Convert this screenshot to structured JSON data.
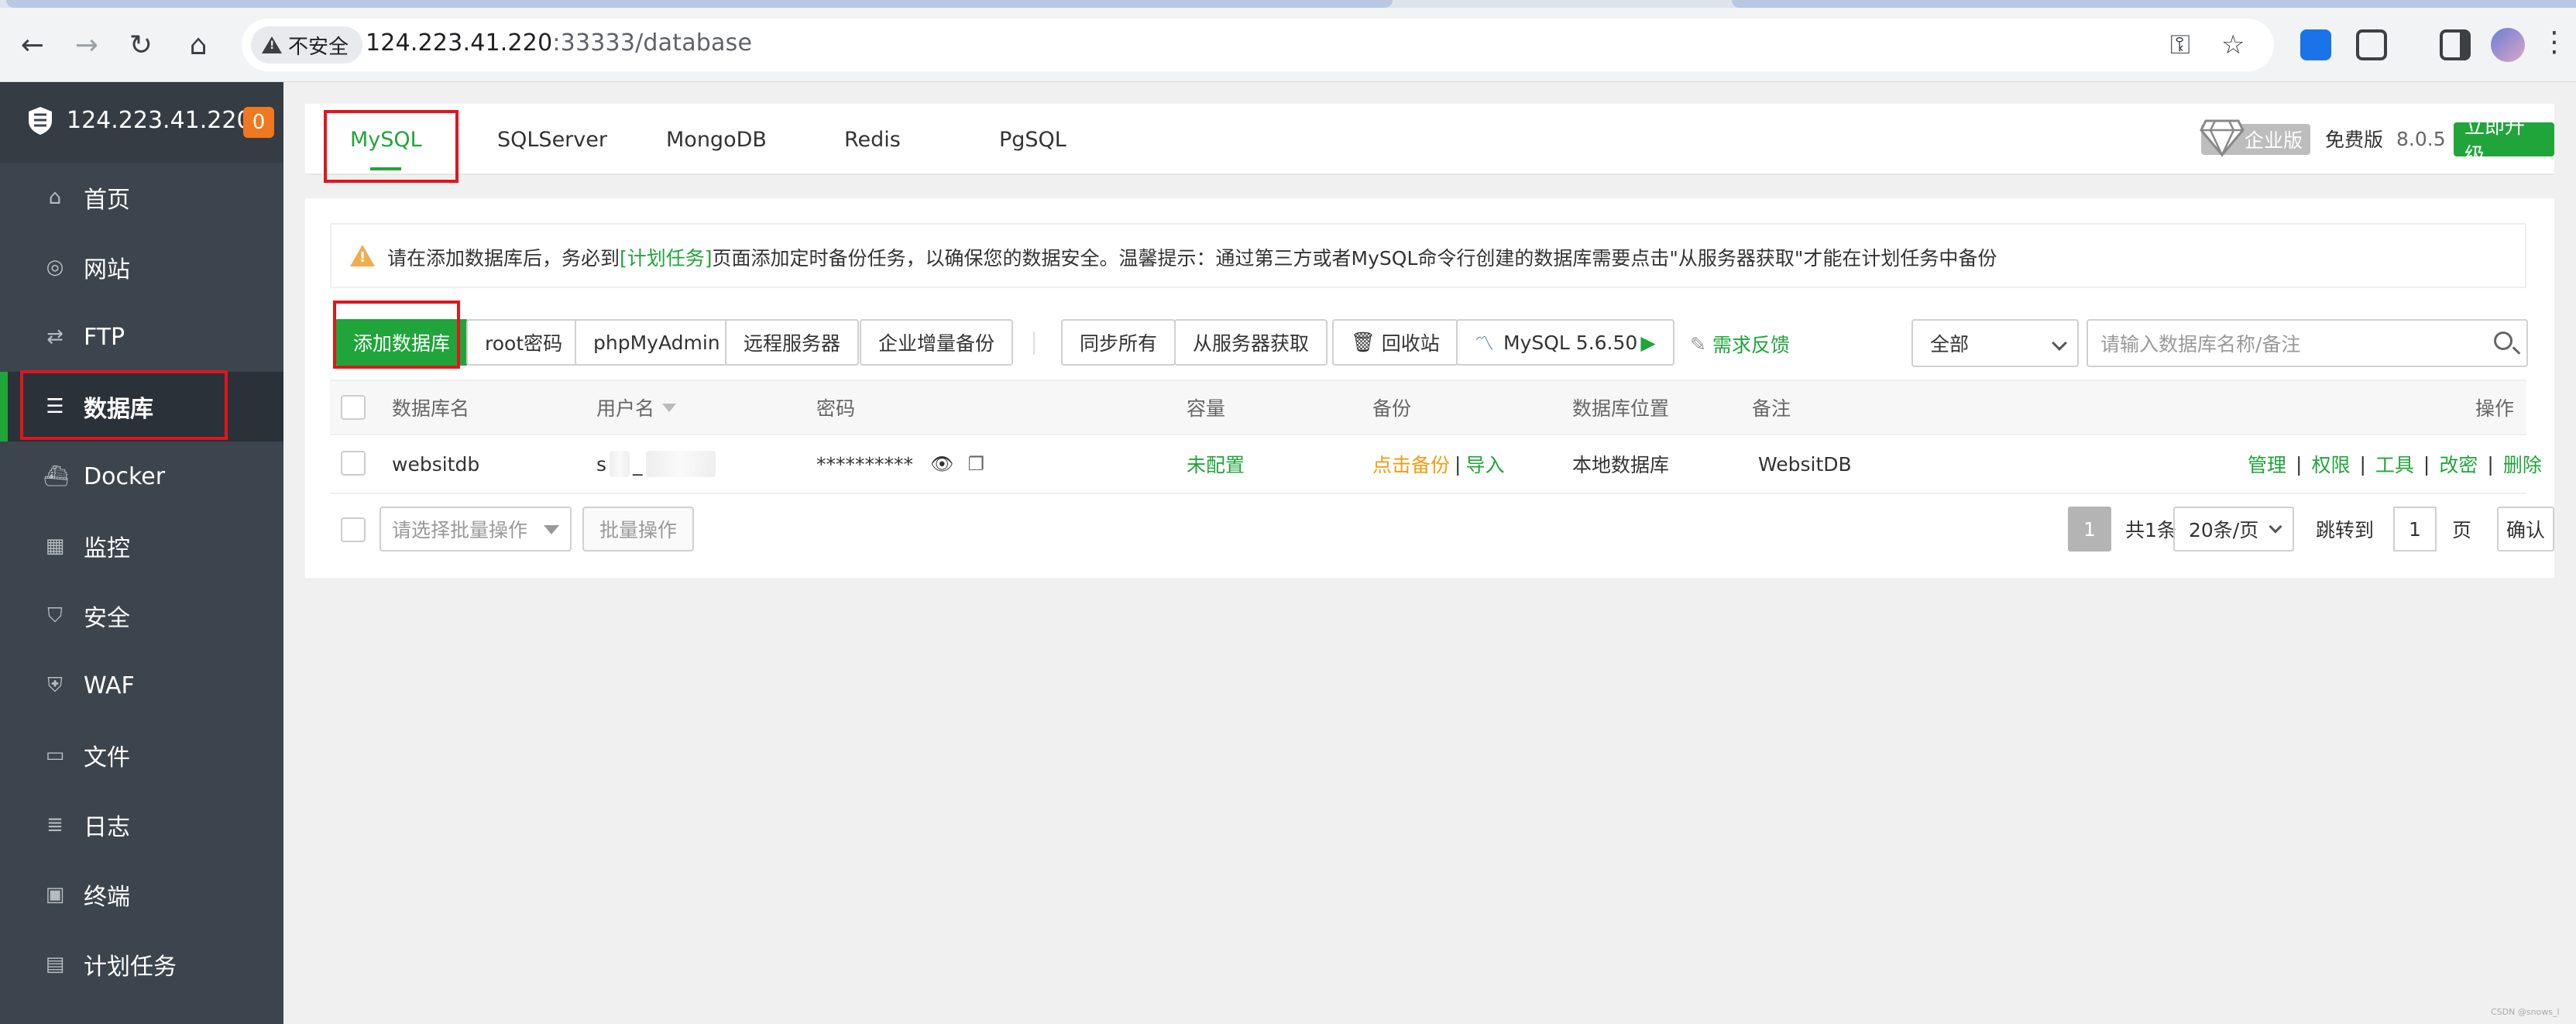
{
  "browser": {
    "insecure_label": "不安全",
    "url_host": "124.223.41.220",
    "url_rest": ":33333/database"
  },
  "sidebar": {
    "server_ip": "124.223.41.220",
    "badge": "0",
    "items": [
      {
        "label": "首页",
        "icon": "home-icon",
        "glyph": "⌂"
      },
      {
        "label": "网站",
        "icon": "globe-icon",
        "glyph": "◎"
      },
      {
        "label": "FTP",
        "icon": "ftp-icon",
        "glyph": "⇄"
      },
      {
        "label": "数据库",
        "icon": "database-icon",
        "glyph": "☰"
      },
      {
        "label": "Docker",
        "icon": "docker-icon",
        "glyph": "⛴"
      },
      {
        "label": "监控",
        "icon": "monitor-icon",
        "glyph": "▦"
      },
      {
        "label": "安全",
        "icon": "shield-icon",
        "glyph": "⛉"
      },
      {
        "label": "WAF",
        "icon": "waf-icon",
        "glyph": "⛨"
      },
      {
        "label": "文件",
        "icon": "folder-icon",
        "glyph": "▭"
      },
      {
        "label": "日志",
        "icon": "log-icon",
        "glyph": "≣"
      },
      {
        "label": "终端",
        "icon": "terminal-icon",
        "glyph": "▣"
      },
      {
        "label": "计划任务",
        "icon": "calendar-icon",
        "glyph": "▤"
      }
    ]
  },
  "db_tabs": [
    "MySQL",
    "SQLServer",
    "MongoDB",
    "Redis",
    "PgSQL"
  ],
  "edition": {
    "enterprise": "企业版",
    "free": "免费版",
    "version": "8.0.5",
    "upgrade": "立即升级"
  },
  "notice": {
    "before": "请在添加数据库后，务必到",
    "link": "[计划任务]",
    "after": "页面添加定时备份任务，以确保您的数据安全。温馨提示：通过第三方或者MySQL命令行创建的数据库需要点击\"从服务器获取\"才能在计划任务中备份"
  },
  "toolbar": {
    "add_db": "添加数据库",
    "root_pwd": "root密码",
    "phpmyadmin": "phpMyAdmin",
    "remote": "远程服务器",
    "incremental": "企业增量备份",
    "sync_all": "同步所有",
    "fetch": "从服务器获取",
    "recycle": "回收站",
    "mysql_version": "MySQL 5.6.50",
    "feedback": "需求反馈",
    "filter": "全部",
    "search_placeholder": "请输入数据库名称/备注"
  },
  "table": {
    "headers": {
      "name": "数据库名",
      "user": "用户名",
      "password": "密码",
      "capacity": "容量",
      "backup": "备份",
      "location": "数据库位置",
      "remark": "备注",
      "ops": "操作"
    },
    "rows": [
      {
        "name": "websitdb",
        "user": "s",
        "user_suffix": "_",
        "password": "**********",
        "capacity": "未配置",
        "backup_click": "点击备份",
        "backup_import": "导入",
        "location": "本地数据库",
        "remark": "WebsitDB",
        "ops": [
          "管理",
          "权限",
          "工具",
          "改密",
          "删除"
        ]
      }
    ]
  },
  "footer": {
    "batch_placeholder": "请选择批量操作",
    "batch_btn": "批量操作",
    "current_page": "1",
    "total": "共1条",
    "page_size": "20条/页",
    "jump_to": "跳转到",
    "jump_value": "1",
    "page_unit": "页",
    "confirm": "确认"
  },
  "watermark": "CSDN @snows_l",
  "colors": {
    "accent": "#20a53a",
    "sidebar_bg": "#3c444d",
    "highlight": "#e0161d",
    "warning": "#f0ad4e",
    "backup_link": "#f39c12"
  }
}
